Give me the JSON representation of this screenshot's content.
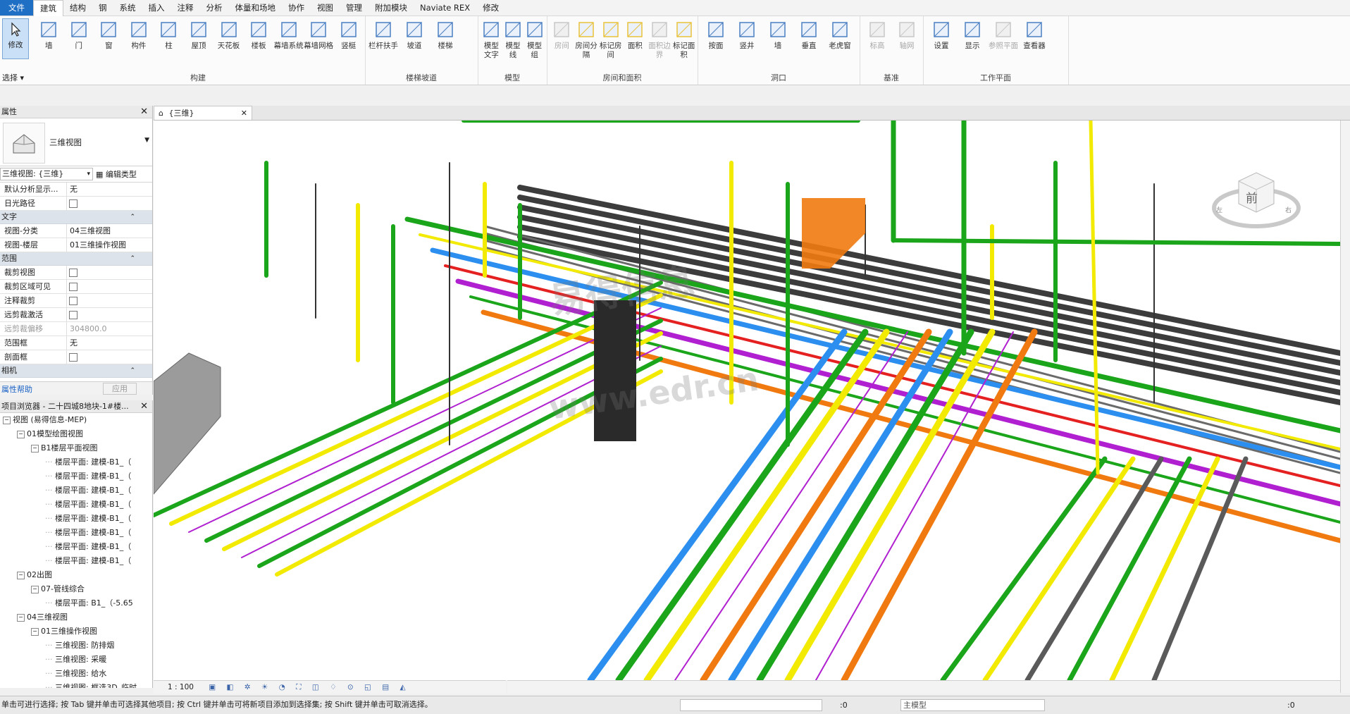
{
  "menu": {
    "items": [
      "文件",
      "建筑",
      "结构",
      "钢",
      "系统",
      "插入",
      "注释",
      "分析",
      "体量和场地",
      "协作",
      "视图",
      "管理",
      "附加模块",
      "Naviate REX",
      "修改"
    ],
    "active_index": 1
  },
  "ribbon": {
    "modify_label": "修改",
    "select_label": "选择",
    "groups": [
      {
        "title": "构建",
        "tools": [
          "墙",
          "门",
          "窗",
          "构件",
          "柱",
          "屋顶",
          "天花板",
          "楼板",
          "幕墙系统",
          "幕墙网格",
          "竖梃"
        ]
      },
      {
        "title": "楼梯坡道",
        "tools": [
          "栏杆扶手",
          "坡道",
          "楼梯"
        ]
      },
      {
        "title": "模型",
        "tools": [
          "模型文字",
          "模型线",
          "模型组"
        ]
      },
      {
        "title": "房间和面积",
        "tools": [
          "房间",
          "房间分隔",
          "标记房间",
          "面积",
          "面积边界",
          "标记面积"
        ]
      },
      {
        "title": "洞口",
        "tools": [
          "按面",
          "竖井",
          "墙",
          "垂直",
          "老虎窗"
        ]
      },
      {
        "title": "基准",
        "tools": [
          "标高",
          "轴网"
        ]
      },
      {
        "title": "工作平面",
        "tools": [
          "设置",
          "显示",
          "参照平面",
          "查看器"
        ]
      }
    ]
  },
  "properties": {
    "title": "属性",
    "type_name": "三维视图",
    "view_selector": "三维视图: {三维}",
    "edit_type": "编辑类型",
    "rows_top": [
      {
        "k": "默认分析显示...",
        "v": "无"
      },
      {
        "k": "日光路径",
        "v": ""
      }
    ],
    "section_text": "文字",
    "rows_text": [
      {
        "k": "视图-分类",
        "v": "04三维视图"
      },
      {
        "k": "视图-楼层",
        "v": "01三维操作视图"
      }
    ],
    "section_range": "范围",
    "rows_range": [
      {
        "k": "裁剪视图",
        "v": ""
      },
      {
        "k": "裁剪区域可见",
        "v": ""
      },
      {
        "k": "注释裁剪",
        "v": ""
      },
      {
        "k": "远剪裁激活",
        "v": ""
      },
      {
        "k": "远剪裁偏移",
        "v": "304800.0"
      },
      {
        "k": "范围框",
        "v": "无"
      },
      {
        "k": "剖面框",
        "v": ""
      }
    ],
    "section_camera": "相机",
    "help": "属性帮助",
    "apply": "应用"
  },
  "browser": {
    "title": "项目浏览器 - 二十四城8地块-1#楼...",
    "nodes": [
      {
        "level": 0,
        "text": "视图 (易得信息-MEP)"
      },
      {
        "level": 1,
        "text": "01模型绘图视图"
      },
      {
        "level": 2,
        "text": "B1楼层平面视图"
      },
      {
        "level": 3,
        "text": "楼层平面: 建模-B1_（"
      },
      {
        "level": 3,
        "text": "楼层平面: 建模-B1_（"
      },
      {
        "level": 3,
        "text": "楼层平面: 建模-B1_（"
      },
      {
        "level": 3,
        "text": "楼层平面: 建模-B1_（"
      },
      {
        "level": 3,
        "text": "楼层平面: 建模-B1_（"
      },
      {
        "level": 3,
        "text": "楼层平面: 建模-B1_（"
      },
      {
        "level": 3,
        "text": "楼层平面: 建模-B1_（"
      },
      {
        "level": 3,
        "text": "楼层平面: 建模-B1_（"
      },
      {
        "level": 1,
        "text": "02出图"
      },
      {
        "level": 2,
        "text": "07-管线综合"
      },
      {
        "level": 3,
        "text": "楼层平面: B1_（-5.65"
      },
      {
        "level": 1,
        "text": "04三维视图"
      },
      {
        "level": 2,
        "text": "01三维操作视图"
      },
      {
        "level": 3,
        "text": "三维视图: 防排烟"
      },
      {
        "level": 3,
        "text": "三维视图: 采暖"
      },
      {
        "level": 3,
        "text": "三维视图: 给水"
      },
      {
        "level": 3,
        "text": "三维视图: 框选3D_临时"
      }
    ]
  },
  "view_tab": {
    "label": "{三维}"
  },
  "viewcube": {
    "face": "前",
    "left": "左",
    "right": "右"
  },
  "viewbar": {
    "scale": "1 : 100"
  },
  "status": {
    "message": "单击可进行选择; 按 Tab 键并单击可选择其他项目; 按 Ctrl 键并单击可将新项目添加到选择集; 按 Shift 键并单击可取消选择。",
    "coord": ":0",
    "model": "主模型",
    "filter": ":0"
  },
  "colors": {
    "accent": "#1f6fc5",
    "pipe_green": "#1aa51a",
    "pipe_yellow": "#f2ea00",
    "pipe_blue": "#2c8ff0",
    "pipe_orange": "#f07a10",
    "pipe_red": "#e52020",
    "pipe_magenta": "#b020d0"
  }
}
